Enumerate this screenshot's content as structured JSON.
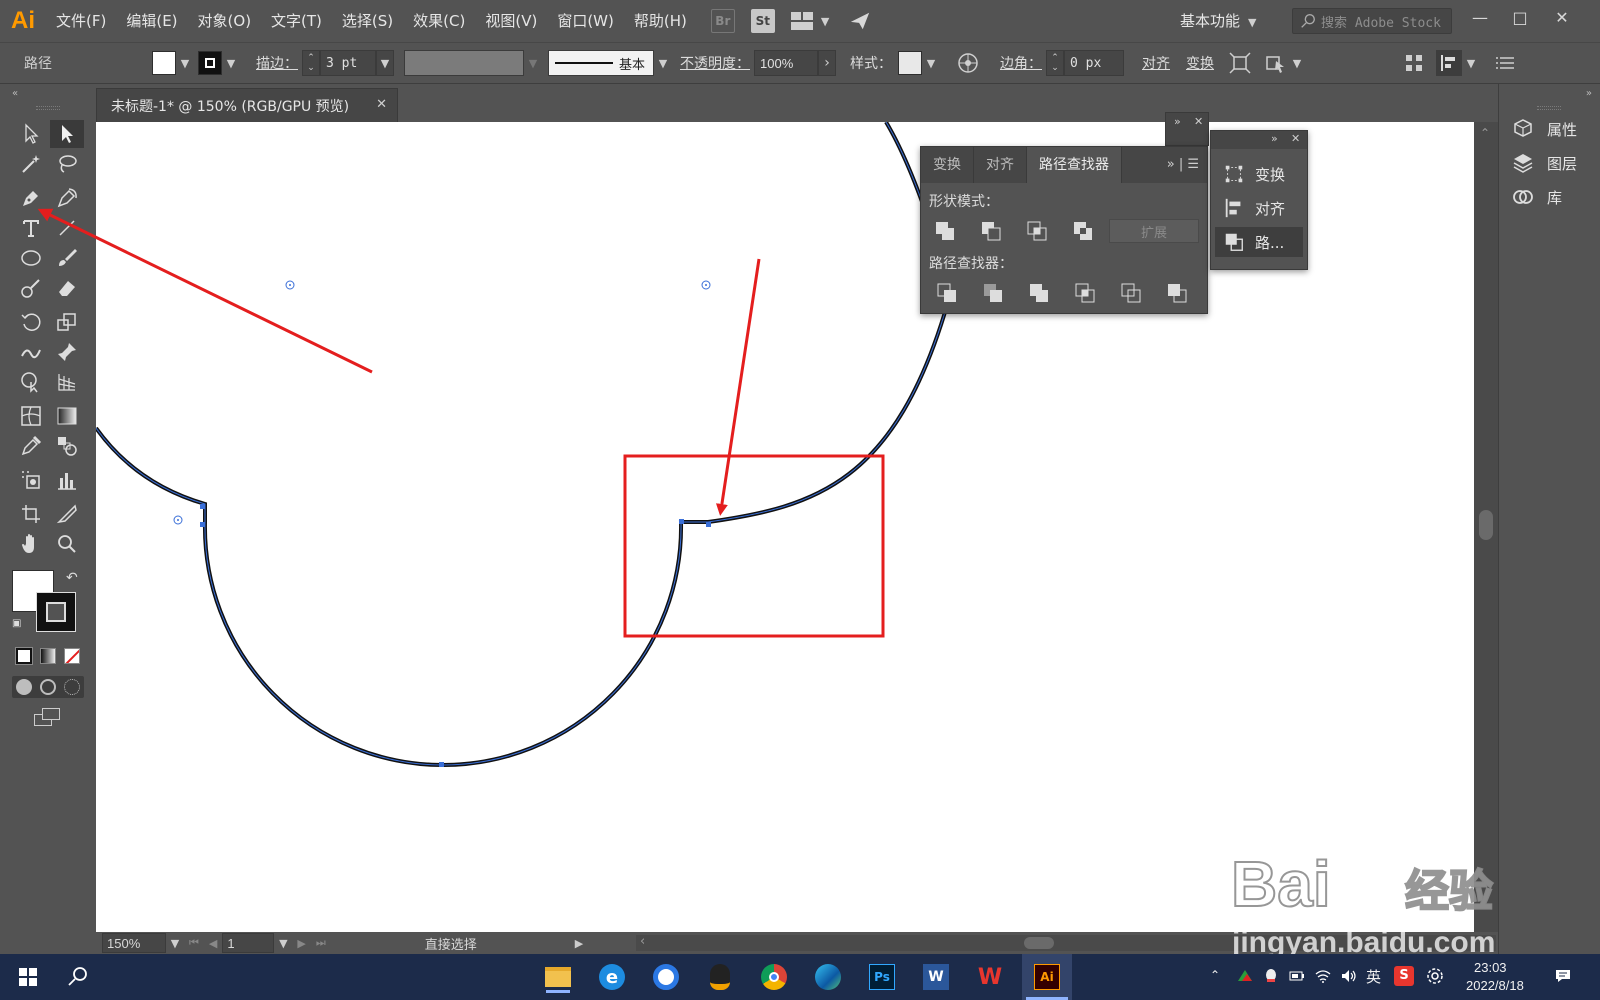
{
  "menu": {
    "logo": "Ai",
    "items": [
      "文件(F)",
      "编辑(E)",
      "对象(O)",
      "文字(T)",
      "选择(S)",
      "效果(C)",
      "视图(V)",
      "窗口(W)",
      "帮助(H)"
    ],
    "bridge": "Br",
    "stock": "St",
    "workspace": "基本功能",
    "search_placeholder": "搜索 Adobe Stock"
  },
  "control": {
    "selection_type": "路径",
    "stroke_label": "描边：",
    "stroke_value": "3 pt",
    "brush_label": "基本",
    "opacity_label": "不透明度：",
    "opacity_value": "100%",
    "style_label": "样式：",
    "corner_label": "边角：",
    "corner_value": "0 px",
    "align_label": "对齐",
    "transform_label": "变换"
  },
  "document": {
    "tab_title": "未标题-1* @ 150% (RGB/GPU 预览)"
  },
  "status": {
    "zoom": "150%",
    "artboard": "1",
    "tool_name": "直接选择"
  },
  "pathfinder": {
    "tabs": [
      "变换",
      "对齐",
      "路径查找器"
    ],
    "shape_modes_label": "形状模式：",
    "expand_label": "扩展",
    "pathfinders_label": "路径查找器："
  },
  "mini_panel": {
    "items": [
      "变换",
      "对齐",
      "路..."
    ]
  },
  "right_dock": {
    "items": [
      "属性",
      "图层",
      "库"
    ]
  },
  "taskbar": {
    "ime": "英",
    "time": "23:03",
    "date": "2022/8/18"
  },
  "watermark": {
    "text": "jingyan.baidu.com"
  },
  "colors": {
    "ui_bg": "#535353",
    "annotation_red": "#e41e1e",
    "anchor_blue": "#3a6fd8",
    "ai_orange": "#ff9a00"
  }
}
